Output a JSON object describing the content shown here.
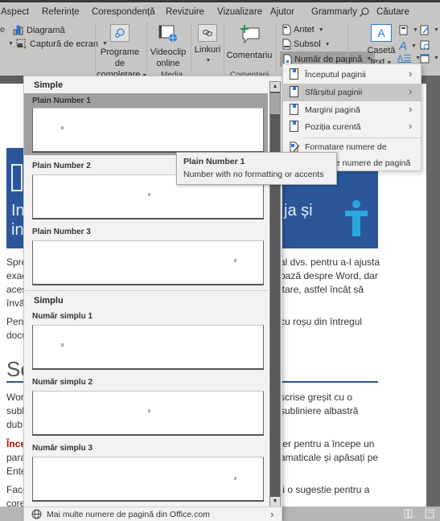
{
  "tabs": [
    "Aspect",
    "Referințe",
    "Corespondență",
    "Revizuire",
    "Vizualizare",
    "Ajutor",
    "Grammarly"
  ],
  "search": {
    "label": "Căutare",
    "icon": "search-icon"
  },
  "ribbon": {
    "diagram": "Diagramă",
    "screenshot": "Captură de ecran",
    "addins": [
      "Programe de",
      "completare"
    ],
    "online_video": [
      "Videoclip",
      "online"
    ],
    "links": "Linkuri",
    "comment": "Comentariu",
    "header": "Antet",
    "footer": "Subsol",
    "page_number": "Număr de pagină",
    "text_box": [
      "Casetă",
      "text"
    ],
    "groups": {
      "media": "Media",
      "comments": "Comentarii"
    }
  },
  "gallery": {
    "sections": [
      {
        "heading": "Simple",
        "items": [
          {
            "label": "Plain Number 1",
            "align": "left",
            "selected": true
          },
          {
            "label": "Plain Number 2",
            "align": "center",
            "selected": false
          },
          {
            "label": "Plain Number 3",
            "align": "right",
            "selected": false
          }
        ]
      },
      {
        "heading": "Simplu",
        "items": [
          {
            "label": "Număr simplu 1",
            "align": "left",
            "selected": false
          },
          {
            "label": "Număr simplu 2",
            "align": "center",
            "selected": false
          },
          {
            "label": "Număr simplu 3",
            "align": "right",
            "selected": false
          }
        ]
      }
    ],
    "footer": "Mai multe numere de pagină din Office.com"
  },
  "submenu": {
    "items": [
      {
        "label": "Începutul paginii",
        "accel": "Î",
        "has_submenu": true,
        "highlighted": false
      },
      {
        "label": "Sfârșitul paginii",
        "accel": "S",
        "has_submenu": true,
        "highlighted": true
      },
      {
        "label": "Margini pagină",
        "accel": "M",
        "has_submenu": true,
        "highlighted": false
      },
      {
        "label": "Poziția curentă",
        "accel": "P",
        "has_submenu": true,
        "highlighted": false
      },
      {
        "label": "Formatare numere de pagină...",
        "accel": "F",
        "has_submenu": false,
        "highlighted": false
      },
      {
        "label": "Eliminare numere de pagină",
        "accel": "d",
        "has_submenu": false,
        "highlighted": false
      }
    ]
  },
  "tooltip": {
    "title": "Plain Number 1",
    "description": "Number with no formatting or accents"
  },
  "document": {
    "banner_left": [
      "In",
      "in"
    ],
    "banner_right": "ja și",
    "para1_left": [
      "Spre",
      "exac",
      "aces",
      "învă"
    ],
    "para1_right": [
      "al dvs. pentru a-l ajusta",
      " bază despre Word, dar",
      "itare, astfel încât să",
      ""
    ],
    "para2_left": [
      "Pent",
      "docu"
    ],
    "para2_right": [
      " cu roșu din întregul",
      ""
    ],
    "heading_left": "Sc",
    "para3_left": [
      "Wor",
      "subl",
      "dub"
    ],
    "para3_right": [
      "scrise greșit cu o",
      "subliniere albastră",
      ""
    ],
    "para4_left": [
      "Înce",
      "para",
      "Ente"
    ],
    "para4_right": [
      "ter pentru a începe un",
      "amaticale și apăsați pe",
      ""
    ],
    "para5_left": [
      "Face",
      "core"
    ],
    "para5_right": [
      "ți o sugestie pentru a",
      ""
    ]
  },
  "colors": {
    "accent": "#2b579a",
    "red_text": "#c00000",
    "highlight": "#c8c6c4"
  }
}
